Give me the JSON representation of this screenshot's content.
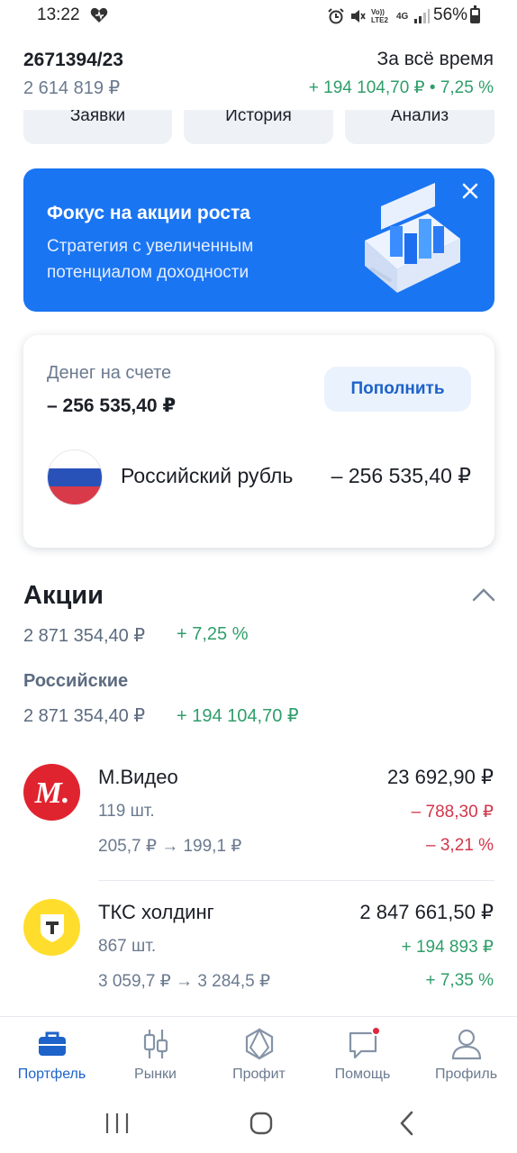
{
  "status_bar": {
    "time": "13:22",
    "battery": "56%",
    "icons": [
      "heart-icon",
      "alarm-icon",
      "mute-icon",
      "volte-icon",
      "4g-icon",
      "signal-icon",
      "battery-icon"
    ],
    "volte": "Vo)) LTE2",
    "net": "4G"
  },
  "header": {
    "account_number": "2671394/23",
    "total_value": "2 614 819 ₽",
    "period_label": "За всё время",
    "period_change": "+ 194 104,70 ₽ • 7,25 %"
  },
  "tabs": [
    {
      "label": "Заявки"
    },
    {
      "label": "История"
    },
    {
      "label": "Анализ"
    }
  ],
  "promo": {
    "title": "Фокус на акции роста",
    "subtitle": "Стратегия с увеличенным потенциалом доходности",
    "accent": "#1a75f3"
  },
  "money": {
    "label": "Денег на счете",
    "amount": "– 256 535,40 ₽",
    "topup_label": "Пополнить",
    "currency_name": "Российский рубль",
    "currency_amount": "– 256 535,40 ₽"
  },
  "shares": {
    "title": "Акции",
    "total": "2 871 354,40 ₽",
    "percent": "+ 7,25 %",
    "group_title": "Российские",
    "group_total": "2 871 354,40 ₽",
    "group_change": "+ 194 104,70 ₽",
    "items": [
      {
        "name": "М.Видео",
        "quantity": "119 шт.",
        "prices": "205,7 ₽  →  199,1 ₽",
        "value": "23 692,90 ₽",
        "change": "– 788,30 ₽",
        "change_pct": "– 3,21 %",
        "trend": "negative",
        "logo_color": "#e0242f"
      },
      {
        "name": "ТКС холдинг",
        "quantity": "867 шт.",
        "prices": "3 059,7 ₽  →  3 284,5 ₽",
        "value": "2 847 661,50 ₽",
        "change": "+ 194 893 ₽",
        "change_pct": "+ 7,35 %",
        "trend": "positive",
        "logo_color": "#ffdd2d"
      }
    ]
  },
  "bottom_nav": [
    {
      "label": "Портфель",
      "icon": "briefcase-icon",
      "active": true
    },
    {
      "label": "Рынки",
      "icon": "candles-icon",
      "active": false
    },
    {
      "label": "Профит",
      "icon": "hexagon-icon",
      "active": false
    },
    {
      "label": "Помощь",
      "icon": "chat-icon",
      "active": false,
      "badge": true
    },
    {
      "label": "Профиль",
      "icon": "person-icon",
      "active": false
    }
  ],
  "colors": {
    "positive": "#2f9e6a",
    "negative": "#d1364a",
    "primary": "#1d63c9"
  }
}
